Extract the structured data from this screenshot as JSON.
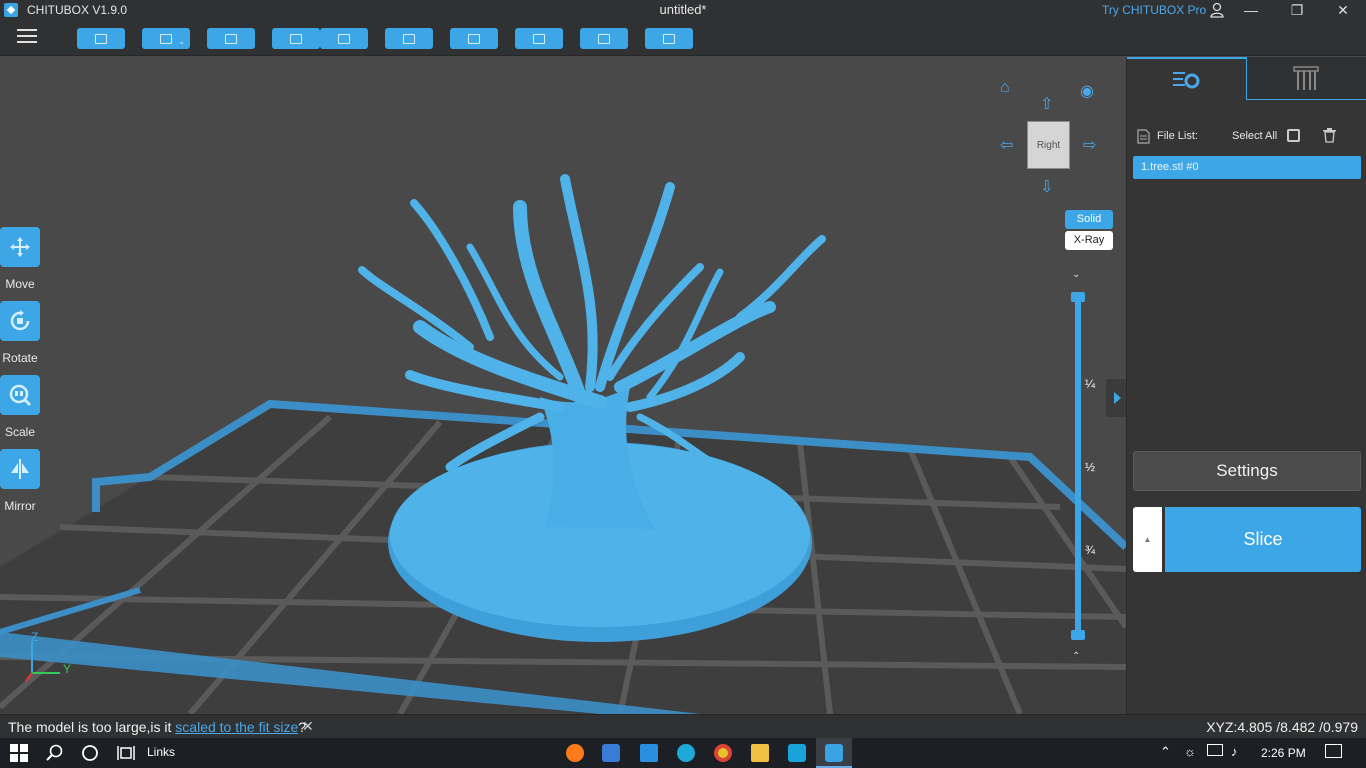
{
  "titlebar": {
    "app_name": "CHITUBOX V1.9.0",
    "document_title": "untitled*",
    "pro_link": "Try CHITUBOX Pro",
    "minimize": "—",
    "restore": "❐",
    "close": "✕"
  },
  "toolbar": {
    "buttons": [
      "open-file",
      "save",
      "open-recent",
      "undo",
      "redo",
      "copy",
      "auto-layout",
      "support",
      "hollow",
      "package"
    ]
  },
  "left_tools": [
    {
      "label": "Move",
      "icon": "move-icon"
    },
    {
      "label": "Rotate",
      "icon": "rotate-icon"
    },
    {
      "label": "Scale",
      "icon": "scale-icon"
    },
    {
      "label": "Mirror",
      "icon": "mirror-icon"
    }
  ],
  "view": {
    "cube_face": "Right",
    "solid_label": "Solid",
    "xray_label": "X-Ray",
    "slider_ticks": [
      "¼",
      "½",
      "¾"
    ]
  },
  "axes": {
    "z": "Z",
    "y": "Y"
  },
  "right_panel": {
    "file_list_label": "File List:",
    "select_all_label": "Select All",
    "files": [
      "1.tree.stl #0"
    ],
    "settings_label": "Settings",
    "slice_label": "Slice"
  },
  "statusbar": {
    "message_prefix": "The model is too large,is it ",
    "message_link": "scaled to the fit size",
    "message_suffix": "?",
    "coordinates": "XYZ:4.805 /8.482 /0.979"
  },
  "taskbar": {
    "links_label": "Links",
    "time": "2:26 PM"
  },
  "colors": {
    "accent": "#3da6e6",
    "panel": "#353535",
    "viewport": "#494949",
    "model": "#4fb3ea"
  }
}
